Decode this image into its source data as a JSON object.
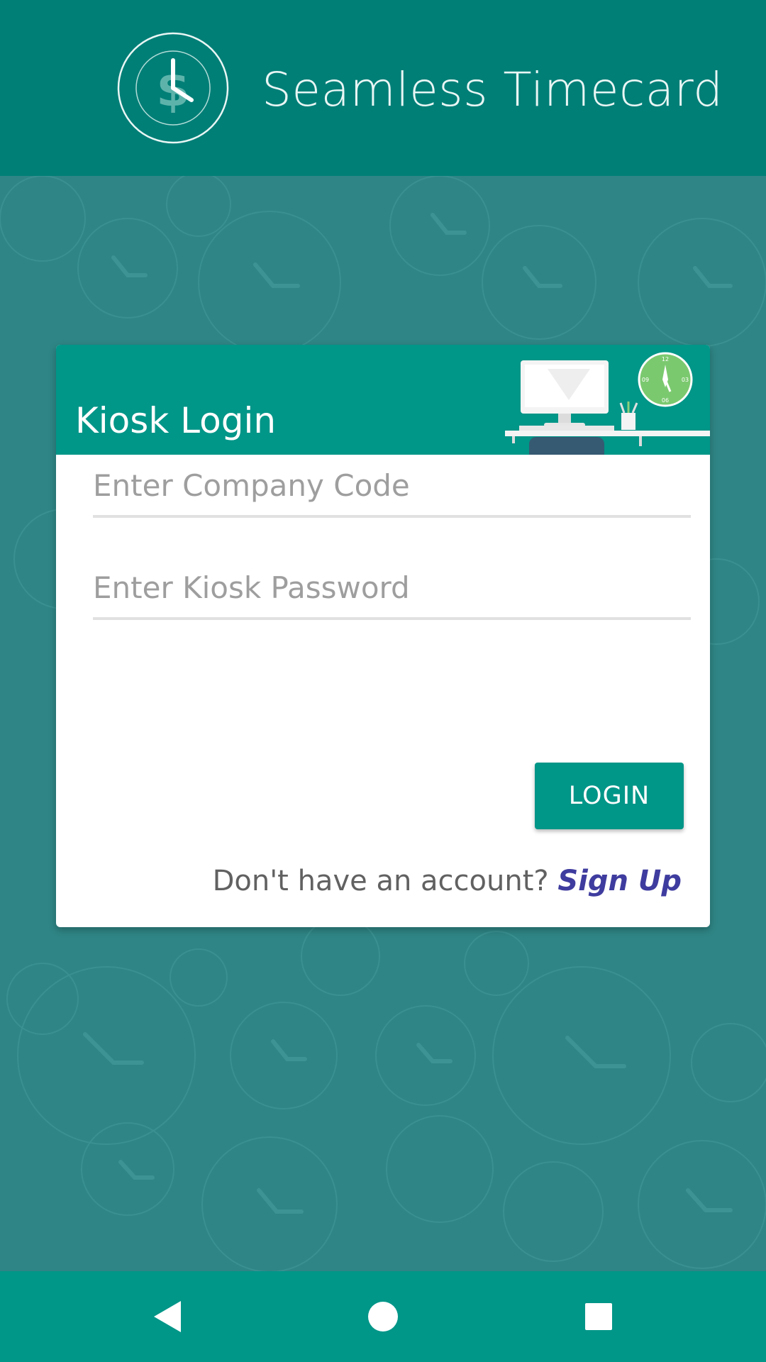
{
  "app": {
    "title": "Seamless Timecard",
    "logo_icon": "clock-dollar-icon"
  },
  "card": {
    "title": "Kiosk Login",
    "illustration": "desk-monitor-clock-illustration",
    "clock_labels": [
      "12",
      "03",
      "06",
      "09"
    ]
  },
  "form": {
    "company_code": {
      "value": "",
      "placeholder": "Enter Company Code"
    },
    "kiosk_password": {
      "value": "",
      "placeholder": "Enter Kiosk Password"
    },
    "login_label": "LOGIN",
    "signup_prompt": "Don't have an account? ",
    "signup_link": "Sign Up"
  },
  "nav": {
    "back_icon": "back-triangle-icon",
    "home_icon": "home-circle-icon",
    "recents_icon": "recents-square-icon"
  },
  "colors": {
    "header": "#007f77",
    "background": "#2f8585",
    "accent": "#009688",
    "link": "#3f3c9f",
    "clock": "#7bc96f"
  }
}
